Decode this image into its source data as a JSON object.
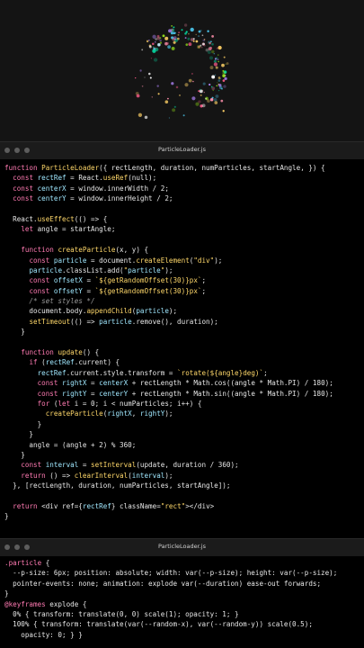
{
  "editor1": {
    "title": "ParticleLoader.js",
    "lines": [
      "function ParticleLoader({ rectLength, duration, numParticles, startAngle, }) {",
      "  const rectRef = React.useRef(null);",
      "  const centerX = window.innerWidth / 2;",
      "  const centerY = window.innerHeight / 2;",
      "",
      "  React.useEffect(() => {",
      "    let angle = startAngle;",
      "",
      "    function createParticle(x, y) {",
      "      const particle = document.createElement(\"div\");",
      "      particle.classList.add(\"particle\");",
      "      const offsetX = `${getRandomOffset(30)}px`;",
      "      const offsetY = `${getRandomOffset(30)}px`;",
      "      /* set styles */",
      "      document.body.appendChild(particle);",
      "      setTimeout(() => particle.remove(), duration);",
      "    }",
      "",
      "    function update() {",
      "      if (rectRef.current) {",
      "        rectRef.current.style.transform = `rotate(${angle}deg)`;",
      "        const rightX = centerX + rectLength * Math.cos((angle * Math.PI) / 180);",
      "        const rightY = centerY + rectLength * Math.sin((angle * Math.PI) / 180);",
      "        for (let i = 0; i < numParticles; i++) {",
      "          createParticle(rightX, rightY);",
      "        }",
      "      }",
      "      angle = (angle + 2) % 360;",
      "    }",
      "    const interval = setInterval(update, duration / 360);",
      "    return () => clearInterval(interval);",
      "  }, [rectLength, duration, numParticles, startAngle]);",
      "",
      "  return <div ref={rectRef} className=\"rect\"></div>",
      "}"
    ]
  },
  "editor2": {
    "title": "ParticleLoader.js",
    "lines": [
      ".particle {",
      "  --p-size: 6px; position: absolute; width: var(--p-size); height: var(--p-size);",
      "  pointer-events: none; animation: explode var(--duration) ease-out forwards;",
      "}",
      "@keyframes explode {",
      "  0% { transform: translate(0, 0) scale(1); opacity: 1; }",
      "  100% { transform: translate(var(--random-x), var(--random-y)) scale(0.5);",
      "    opacity: 0; } }"
    ]
  },
  "colors": {
    "keyword": "#ff7ab2",
    "function": "#ffd86a",
    "identifier": "#a0e8ff",
    "comment": "#9a9a9a"
  }
}
